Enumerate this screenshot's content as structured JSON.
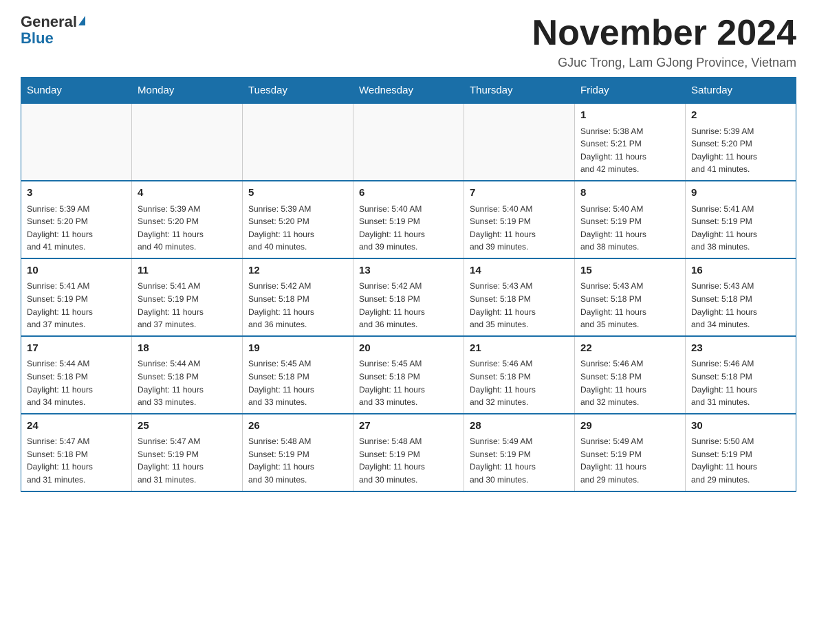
{
  "logo": {
    "general": "General",
    "blue": "Blue"
  },
  "title": "November 2024",
  "location": "GJuc Trong, Lam GJong Province, Vietnam",
  "headers": [
    "Sunday",
    "Monday",
    "Tuesday",
    "Wednesday",
    "Thursday",
    "Friday",
    "Saturday"
  ],
  "weeks": [
    [
      {
        "day": "",
        "info": ""
      },
      {
        "day": "",
        "info": ""
      },
      {
        "day": "",
        "info": ""
      },
      {
        "day": "",
        "info": ""
      },
      {
        "day": "",
        "info": ""
      },
      {
        "day": "1",
        "info": "Sunrise: 5:38 AM\nSunset: 5:21 PM\nDaylight: 11 hours\nand 42 minutes."
      },
      {
        "day": "2",
        "info": "Sunrise: 5:39 AM\nSunset: 5:20 PM\nDaylight: 11 hours\nand 41 minutes."
      }
    ],
    [
      {
        "day": "3",
        "info": "Sunrise: 5:39 AM\nSunset: 5:20 PM\nDaylight: 11 hours\nand 41 minutes."
      },
      {
        "day": "4",
        "info": "Sunrise: 5:39 AM\nSunset: 5:20 PM\nDaylight: 11 hours\nand 40 minutes."
      },
      {
        "day": "5",
        "info": "Sunrise: 5:39 AM\nSunset: 5:20 PM\nDaylight: 11 hours\nand 40 minutes."
      },
      {
        "day": "6",
        "info": "Sunrise: 5:40 AM\nSunset: 5:19 PM\nDaylight: 11 hours\nand 39 minutes."
      },
      {
        "day": "7",
        "info": "Sunrise: 5:40 AM\nSunset: 5:19 PM\nDaylight: 11 hours\nand 39 minutes."
      },
      {
        "day": "8",
        "info": "Sunrise: 5:40 AM\nSunset: 5:19 PM\nDaylight: 11 hours\nand 38 minutes."
      },
      {
        "day": "9",
        "info": "Sunrise: 5:41 AM\nSunset: 5:19 PM\nDaylight: 11 hours\nand 38 minutes."
      }
    ],
    [
      {
        "day": "10",
        "info": "Sunrise: 5:41 AM\nSunset: 5:19 PM\nDaylight: 11 hours\nand 37 minutes."
      },
      {
        "day": "11",
        "info": "Sunrise: 5:41 AM\nSunset: 5:19 PM\nDaylight: 11 hours\nand 37 minutes."
      },
      {
        "day": "12",
        "info": "Sunrise: 5:42 AM\nSunset: 5:18 PM\nDaylight: 11 hours\nand 36 minutes."
      },
      {
        "day": "13",
        "info": "Sunrise: 5:42 AM\nSunset: 5:18 PM\nDaylight: 11 hours\nand 36 minutes."
      },
      {
        "day": "14",
        "info": "Sunrise: 5:43 AM\nSunset: 5:18 PM\nDaylight: 11 hours\nand 35 minutes."
      },
      {
        "day": "15",
        "info": "Sunrise: 5:43 AM\nSunset: 5:18 PM\nDaylight: 11 hours\nand 35 minutes."
      },
      {
        "day": "16",
        "info": "Sunrise: 5:43 AM\nSunset: 5:18 PM\nDaylight: 11 hours\nand 34 minutes."
      }
    ],
    [
      {
        "day": "17",
        "info": "Sunrise: 5:44 AM\nSunset: 5:18 PM\nDaylight: 11 hours\nand 34 minutes."
      },
      {
        "day": "18",
        "info": "Sunrise: 5:44 AM\nSunset: 5:18 PM\nDaylight: 11 hours\nand 33 minutes."
      },
      {
        "day": "19",
        "info": "Sunrise: 5:45 AM\nSunset: 5:18 PM\nDaylight: 11 hours\nand 33 minutes."
      },
      {
        "day": "20",
        "info": "Sunrise: 5:45 AM\nSunset: 5:18 PM\nDaylight: 11 hours\nand 33 minutes."
      },
      {
        "day": "21",
        "info": "Sunrise: 5:46 AM\nSunset: 5:18 PM\nDaylight: 11 hours\nand 32 minutes."
      },
      {
        "day": "22",
        "info": "Sunrise: 5:46 AM\nSunset: 5:18 PM\nDaylight: 11 hours\nand 32 minutes."
      },
      {
        "day": "23",
        "info": "Sunrise: 5:46 AM\nSunset: 5:18 PM\nDaylight: 11 hours\nand 31 minutes."
      }
    ],
    [
      {
        "day": "24",
        "info": "Sunrise: 5:47 AM\nSunset: 5:18 PM\nDaylight: 11 hours\nand 31 minutes."
      },
      {
        "day": "25",
        "info": "Sunrise: 5:47 AM\nSunset: 5:19 PM\nDaylight: 11 hours\nand 31 minutes."
      },
      {
        "day": "26",
        "info": "Sunrise: 5:48 AM\nSunset: 5:19 PM\nDaylight: 11 hours\nand 30 minutes."
      },
      {
        "day": "27",
        "info": "Sunrise: 5:48 AM\nSunset: 5:19 PM\nDaylight: 11 hours\nand 30 minutes."
      },
      {
        "day": "28",
        "info": "Sunrise: 5:49 AM\nSunset: 5:19 PM\nDaylight: 11 hours\nand 30 minutes."
      },
      {
        "day": "29",
        "info": "Sunrise: 5:49 AM\nSunset: 5:19 PM\nDaylight: 11 hours\nand 29 minutes."
      },
      {
        "day": "30",
        "info": "Sunrise: 5:50 AM\nSunset: 5:19 PM\nDaylight: 11 hours\nand 29 minutes."
      }
    ]
  ]
}
